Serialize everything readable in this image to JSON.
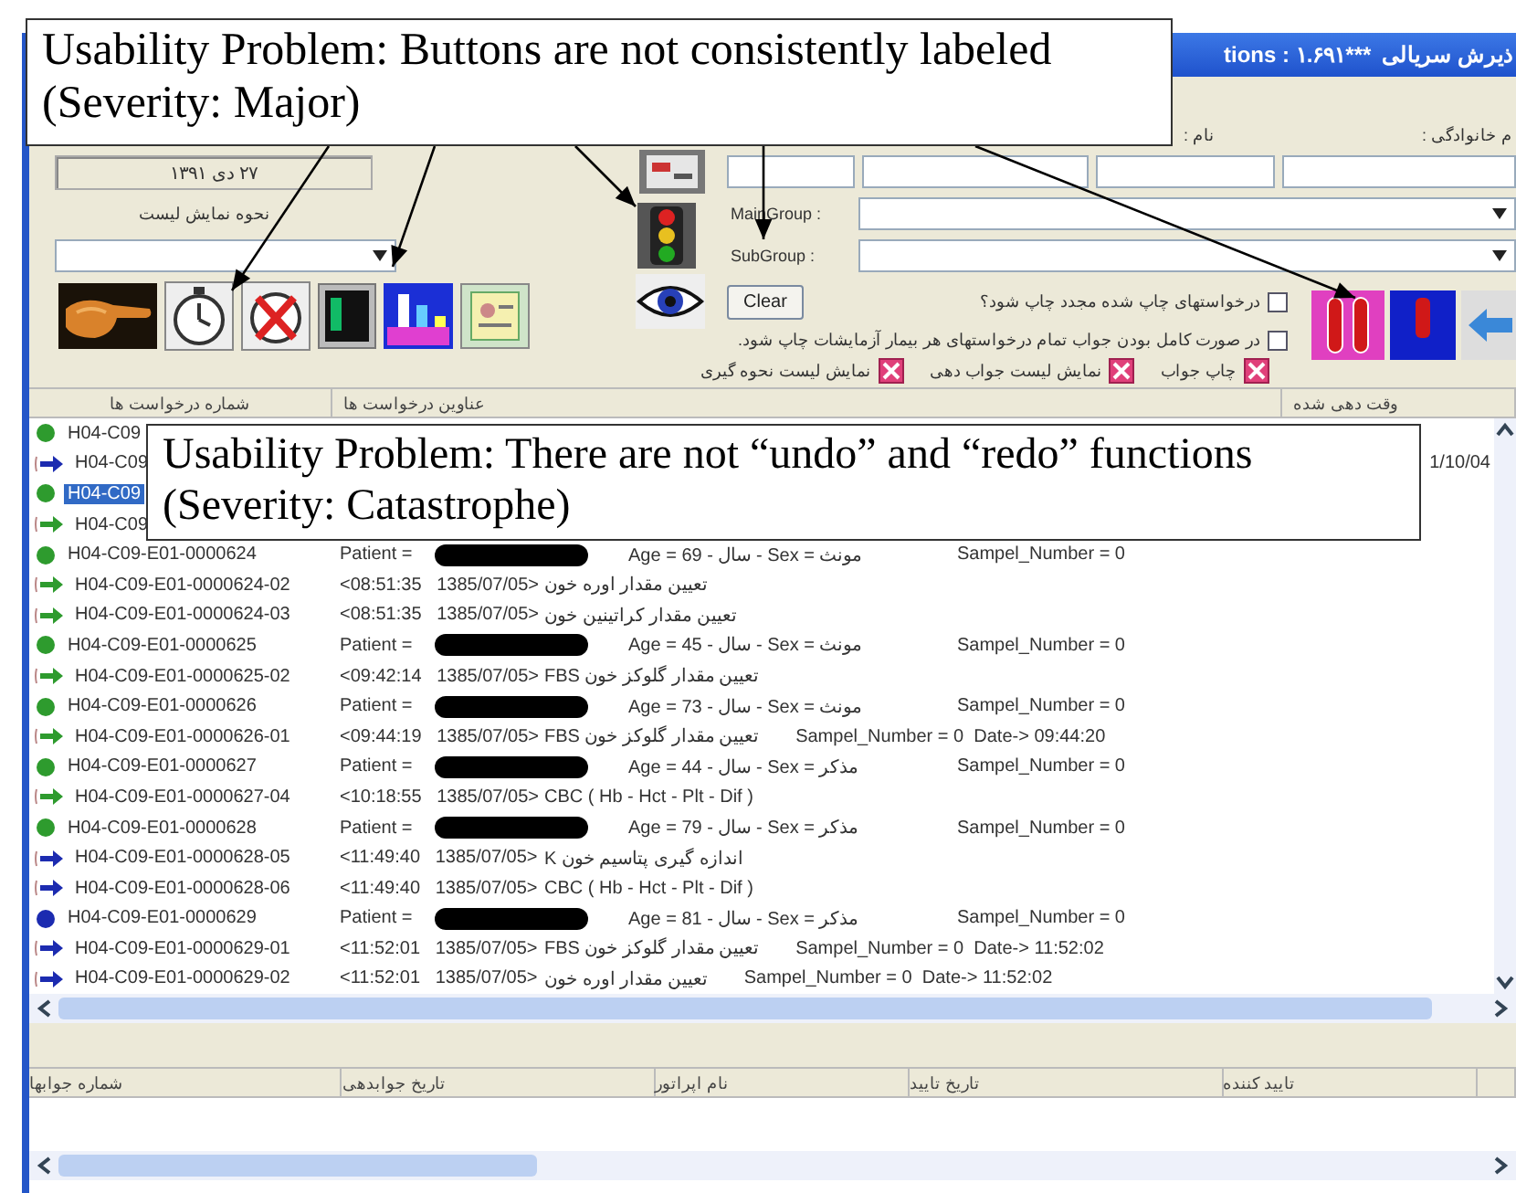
{
  "window": {
    "title": "tions : ۱.۶۹۱***",
    "title_rtl": "ذیرش سریالی"
  },
  "header_labels": [
    "م خانوادگی :",
    "نام :"
  ],
  "date_field": {
    "value": "۲۷ دی ۱۳۹۱"
  },
  "list_mode": {
    "label": "نحوه نمایش لیست"
  },
  "main_group": {
    "label": "MainGroup :"
  },
  "sub_group": {
    "label": "SubGroup :"
  },
  "clear_button": "Clear",
  "options": [
    {
      "label": "درخواستهای چاپ شده مجدد چاپ شود؟",
      "checked": false
    },
    {
      "label": "در صورت کامل بودن جواب تمام درخواستهای هر بیمار آزمایشات چاپ شود.",
      "checked": false
    }
  ],
  "display_options": [
    {
      "label": "چاپ جواب",
      "checked": true
    },
    {
      "label": "نمایش لیست جواب دهی",
      "checked": true
    },
    {
      "label": "نمایش لیست نحوه گیری",
      "checked": true
    }
  ],
  "requests": {
    "columns": [
      "وقت دهی شده",
      "عناوین درخواست ها",
      "شماره درخواست ها"
    ],
    "rows": [
      {
        "kind": "patient",
        "color": "#2e9b2e",
        "selected": false,
        "id": "H04-C09"
      },
      {
        "kind": "test",
        "color": "#1c2bb0",
        "selected": false,
        "id": "H04-C09",
        "scheduled": "1/10/04"
      },
      {
        "kind": "patient",
        "color": "#2e9b2e",
        "selected": true,
        "id": "H04-C09"
      },
      {
        "kind": "test",
        "color": "#2e9b2e",
        "selected": false,
        "id": "H04-C09"
      },
      {
        "kind": "patient",
        "color": "#2e9b2e",
        "selected": false,
        "id": "H04-C09-E01-0000624",
        "lead": "Patient =",
        "detail": "Age = 69 - سال - Sex = مونث",
        "sample": "Sampel_Number = 0"
      },
      {
        "kind": "test",
        "color": "#2e9b2e",
        "selected": false,
        "id": "H04-C09-E01-0000624-02",
        "lead": "<08:51:35   1385/07/05>",
        "detail": "تعیین مقدار اوره خون"
      },
      {
        "kind": "test",
        "color": "#2e9b2e",
        "selected": false,
        "id": "H04-C09-E01-0000624-03",
        "lead": "<08:51:35   1385/07/05>",
        "detail": "تعیین مقدار کراتینین خون"
      },
      {
        "kind": "patient",
        "color": "#2e9b2e",
        "selected": false,
        "id": "H04-C09-E01-0000625",
        "lead": "Patient =",
        "detail": "Age = 45 - سال - Sex = مونث",
        "sample": "Sampel_Number = 0"
      },
      {
        "kind": "test",
        "color": "#2e9b2e",
        "selected": false,
        "id": "H04-C09-E01-0000625-02",
        "lead": "<09:42:14   1385/07/05>",
        "detail": "تعیین مقدار گلوکز خون FBS"
      },
      {
        "kind": "patient",
        "color": "#2e9b2e",
        "selected": false,
        "id": "H04-C09-E01-0000626",
        "lead": "Patient =",
        "detail": "Age = 73 - سال - Sex = مونث",
        "sample": "Sampel_Number = 0"
      },
      {
        "kind": "test",
        "color": "#2e9b2e",
        "selected": false,
        "id": "H04-C09-E01-0000626-01",
        "lead": "<09:44:19   1385/07/05>",
        "detail": "تعیین مقدار گلوکز خون FBS",
        "sample": "Sampel_Number = 0  Date-> 09:44:20"
      },
      {
        "kind": "patient",
        "color": "#2e9b2e",
        "selected": false,
        "id": "H04-C09-E01-0000627",
        "lead": "Patient =",
        "detail": "Age = 44 - سال - Sex = مذکر",
        "sample": "Sampel_Number = 0"
      },
      {
        "kind": "test",
        "color": "#2e9b2e",
        "selected": false,
        "id": "H04-C09-E01-0000627-04",
        "lead": "<10:18:55   1385/07/05>",
        "detail": "CBC ( Hb - Hct - Plt - Dif )"
      },
      {
        "kind": "patient",
        "color": "#2e9b2e",
        "selected": false,
        "id": "H04-C09-E01-0000628",
        "lead": "Patient =",
        "detail": "Age = 79 - سال - Sex = مذکر",
        "sample": "Sampel_Number = 0"
      },
      {
        "kind": "test",
        "color": "#1c2bb0",
        "selected": false,
        "id": "H04-C09-E01-0000628-05",
        "lead": "<11:49:40   1385/07/05>",
        "detail": "اندازه گیری پتاسیم خون K"
      },
      {
        "kind": "test",
        "color": "#1c2bb0",
        "selected": false,
        "id": "H04-C09-E01-0000628-06",
        "lead": "<11:49:40   1385/07/05>",
        "detail": "CBC ( Hb - Hct - Plt - Dif )"
      },
      {
        "kind": "patient",
        "color": "#1c2bb0",
        "selected": false,
        "id": "H04-C09-E01-0000629",
        "lead": "Patient =",
        "detail": "Age = 81 - سال - Sex = مذکر",
        "sample": "Sampel_Number = 0"
      },
      {
        "kind": "test",
        "color": "#1c2bb0",
        "selected": false,
        "id": "H04-C09-E01-0000629-01",
        "lead": "<11:52:01   1385/07/05>",
        "detail": "تعیین مقدار گلوکز خون FBS",
        "sample": "Sampel_Number = 0  Date-> 11:52:02"
      },
      {
        "kind": "test",
        "color": "#1c2bb0",
        "selected": false,
        "id": "H04-C09-E01-0000629-02",
        "lead": "<11:52:01   1385/07/05>",
        "detail": "تعیین مقدار اوره خون",
        "sample": "Sampel_Number = 0  Date-> 11:52:02"
      }
    ]
  },
  "results": {
    "columns": [
      "تایید کننده",
      "تاریخ تایید",
      "نام اپراتور",
      "تاریخ جوابدهی",
      "شماره جوابها"
    ]
  },
  "callouts": [
    {
      "text": "Usability Problem: Buttons are not consistently labeled\n(Severity: Major)"
    },
    {
      "text": "Usability Problem: There are not “undo” and “redo” functions\n(Severity: Catastrophe)"
    }
  ]
}
